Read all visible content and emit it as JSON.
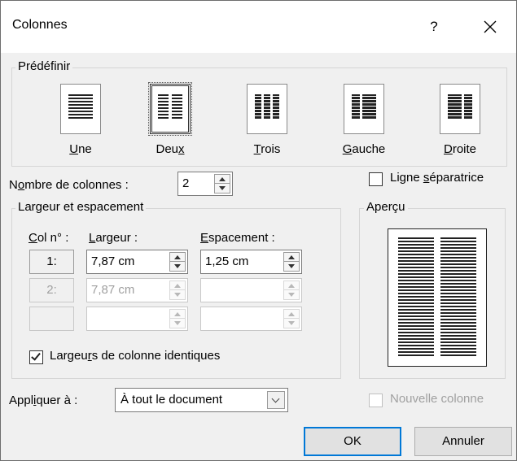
{
  "dialog": {
    "title": "Colonnes",
    "help_label": "?",
    "close_label": "✕"
  },
  "presets": {
    "group_label": "Prédéfinir",
    "items": [
      {
        "label_u": "U",
        "label_rest": "ne",
        "icon": "one-column-icon"
      },
      {
        "label_pre": "Deu",
        "label_u": "x",
        "icon": "two-columns-icon",
        "selected": true
      },
      {
        "label_u": "T",
        "label_rest": "rois",
        "icon": "three-columns-icon"
      },
      {
        "label_u": "G",
        "label_rest": "auche",
        "icon": "left-column-icon"
      },
      {
        "label_u": "D",
        "label_rest": "roite",
        "icon": "right-column-icon"
      }
    ]
  },
  "column_count": {
    "label_pre": "N",
    "label_u": "o",
    "label_rest": "mbre de colonnes :",
    "value": "2"
  },
  "separator_line": {
    "label_pre": "Ligne ",
    "label_u": "s",
    "label_rest": "éparatrice",
    "checked": false
  },
  "width_spacing": {
    "group_label": "Largeur et espacement",
    "col_header_u": "C",
    "col_header_rest": "ol n° :",
    "width_header_u": "L",
    "width_header_rest": "argeur :",
    "spacing_header_u": "E",
    "spacing_header_rest": "spacement :",
    "rows": [
      {
        "col": "1:",
        "width": "7,87 cm",
        "spacing": "1,25 cm",
        "enabled": true
      },
      {
        "col": "2:",
        "width": "7,87 cm",
        "spacing": "",
        "enabled": false
      },
      {
        "col": "",
        "width": "",
        "spacing": "",
        "enabled": false
      }
    ],
    "equal_width_pre": "Largeu",
    "equal_width_u": "r",
    "equal_width_rest": "s de colonne identiques",
    "equal_width_checked": true
  },
  "preview": {
    "group_label": "Aperçu",
    "columns": 2
  },
  "apply_to": {
    "label_pre": "Appl",
    "label_u": "i",
    "label_rest": "quer à :",
    "value": "À tout le document"
  },
  "new_column": {
    "label": "Nouvelle colonne",
    "enabled": false
  },
  "buttons": {
    "ok": "OK",
    "cancel": "Annuler"
  },
  "colors": {
    "dialog_bg": "#f0f0f0",
    "accent": "#0078d7",
    "disabled_text": "#a0a0a0"
  }
}
